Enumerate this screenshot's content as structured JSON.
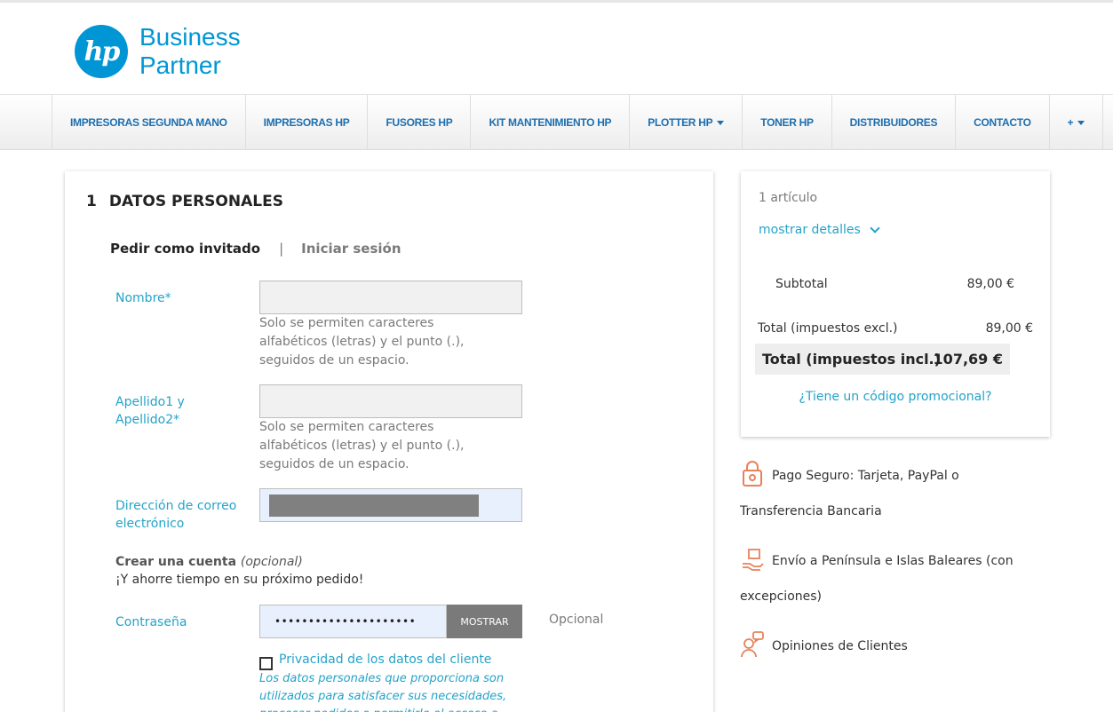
{
  "header": {
    "logo_mark": "hp",
    "logo_line1": "Business",
    "logo_line2": "Partner"
  },
  "nav": {
    "items": [
      "IMPRESORAS SEGUNDA MANO",
      "IMPRESORAS HP",
      "FUSORES HP",
      "KIT MANTENIMIENTO HP",
      "PLOTTER HP",
      "TONER HP",
      "DISTRIBUIDORES",
      "CONTACTO",
      "+"
    ]
  },
  "form": {
    "step_number": "1",
    "step_title": "DATOS PERSONALES",
    "tab_guest": "Pedir como invitado",
    "tab_separator": "|",
    "tab_login": "Iniciar sesión",
    "first_name_label": "Nombre*",
    "first_name_value": "",
    "name_hint": "Solo se permiten caracteres alfabéticos (letras) y el punto (.), seguidos de un espacio.",
    "last_name_label_1": "Apellido1 y",
    "last_name_label_2": "Apellido2*",
    "last_name_value": "",
    "email_label_1": "Dirección de correo",
    "email_label_2": "electrónico",
    "create_account_title": "Crear una cuenta",
    "create_account_optional": "(opcional)",
    "create_account_sub": "¡Y ahorre tiempo en su próximo pedido!",
    "password_label": "Contraseña",
    "password_value": "•••••••••••••••••••••",
    "password_show": "MOSTRAR",
    "password_optional": "Opcional",
    "privacy_label": "Privacidad de los datos del cliente",
    "privacy_text": "Los datos personales que proporciona son utilizados para satisfacer sus necesidades, procesar pedidos o permitirle el acceso a una"
  },
  "summary": {
    "item_count": "1 artículo",
    "show_details": "mostrar detalles",
    "subtotal_label": "Subtotal",
    "subtotal_value": "89,00 €",
    "total_excl_label": "Total (impuestos excl.)",
    "total_excl_value": "89,00 €",
    "total_incl_label": "Total (impuestos incl.)",
    "total_incl_value": "107,69 €",
    "promo": "¿Tiene un código promocional?"
  },
  "reassurance": {
    "payment": "Pago Seguro: Tarjeta, PayPal o Transferencia Bancaria",
    "shipping": "Envío a Península e Islas Baleares (con excepciones)",
    "reviews": "Opiniones de Clientes"
  },
  "colors": {
    "accent": "#24a3c8",
    "brand": "#0096d6",
    "nav_text": "#1b6fb0",
    "icon_orange": "#e8825a"
  }
}
